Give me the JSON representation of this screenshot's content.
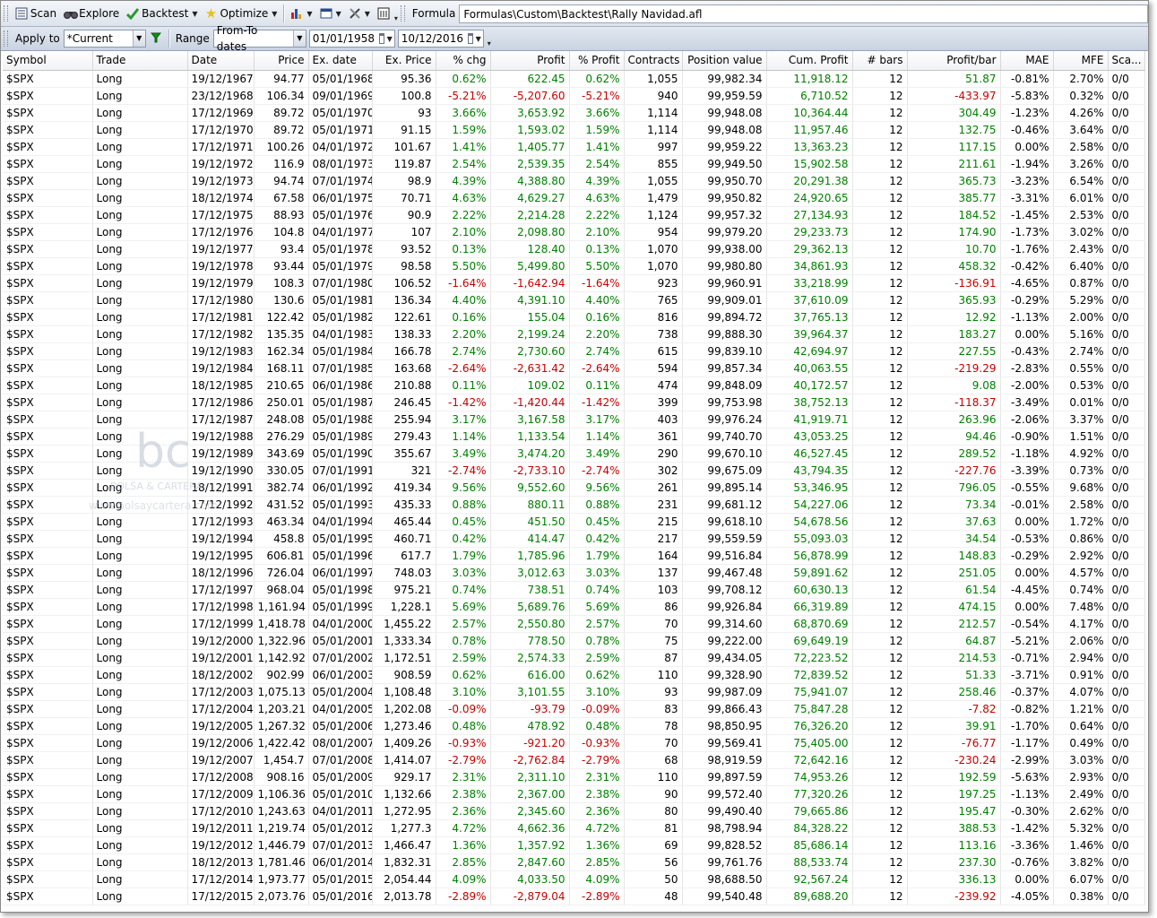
{
  "toolbar": {
    "scan_label": "Scan",
    "explore_label": "Explore",
    "backtest_label": "Backtest",
    "optimize_label": "Optimize",
    "formula_label": "Formula",
    "formula_value": "Formulas\\Custom\\Backtest\\Rally Navidad.afl"
  },
  "filter": {
    "apply_to_label": "Apply to",
    "apply_to_value": "*Current",
    "range_label": "Range",
    "range_value": "From-To dates",
    "from_date": "01/01/1958",
    "to_date": "10/12/2016"
  },
  "watermark": {
    "logo": "bc",
    "name": "BOLSA & CARTERA",
    "url": "www.bolsaycartera.com"
  },
  "colors": {
    "positive": "#008000",
    "negative": "#c80000"
  },
  "table": {
    "columns": [
      "Symbol",
      "Trade",
      "Date",
      "Price",
      "Ex. date",
      "Ex. Price",
      "% chg",
      "Profit",
      "% Profit",
      "Contracts",
      "Position value",
      "Cum. Profit",
      "# bars",
      "Profit/bar",
      "MAE",
      "MFE",
      "Sca..."
    ],
    "rows": [
      [
        "$SPX",
        "Long",
        "19/12/1967",
        "94.77",
        "05/01/1968",
        "95.36",
        "0.62%",
        "622.45",
        "0.62%",
        "1,055",
        "99,982.34",
        "11,918.12",
        "12",
        "51.87",
        "-0.81%",
        "2.70%",
        "0/0"
      ],
      [
        "$SPX",
        "Long",
        "23/12/1968",
        "106.34",
        "09/01/1969",
        "100.8",
        "-5.21%",
        "-5,207.60",
        "-5.21%",
        "940",
        "99,959.59",
        "6,710.52",
        "12",
        "-433.97",
        "-5.83%",
        "0.32%",
        "0/0"
      ],
      [
        "$SPX",
        "Long",
        "17/12/1969",
        "89.72",
        "05/01/1970",
        "93",
        "3.66%",
        "3,653.92",
        "3.66%",
        "1,114",
        "99,948.08",
        "10,364.44",
        "12",
        "304.49",
        "-1.23%",
        "4.26%",
        "0/0"
      ],
      [
        "$SPX",
        "Long",
        "17/12/1970",
        "89.72",
        "05/01/1971",
        "91.15",
        "1.59%",
        "1,593.02",
        "1.59%",
        "1,114",
        "99,948.08",
        "11,957.46",
        "12",
        "132.75",
        "-0.46%",
        "3.64%",
        "0/0"
      ],
      [
        "$SPX",
        "Long",
        "17/12/1971",
        "100.26",
        "04/01/1972",
        "101.67",
        "1.41%",
        "1,405.77",
        "1.41%",
        "997",
        "99,959.22",
        "13,363.23",
        "12",
        "117.15",
        "0.00%",
        "2.58%",
        "0/0"
      ],
      [
        "$SPX",
        "Long",
        "19/12/1972",
        "116.9",
        "08/01/1973",
        "119.87",
        "2.54%",
        "2,539.35",
        "2.54%",
        "855",
        "99,949.50",
        "15,902.58",
        "12",
        "211.61",
        "-1.94%",
        "3.26%",
        "0/0"
      ],
      [
        "$SPX",
        "Long",
        "19/12/1973",
        "94.74",
        "07/01/1974",
        "98.9",
        "4.39%",
        "4,388.80",
        "4.39%",
        "1,055",
        "99,950.70",
        "20,291.38",
        "12",
        "365.73",
        "-3.23%",
        "6.54%",
        "0/0"
      ],
      [
        "$SPX",
        "Long",
        "18/12/1974",
        "67.58",
        "06/01/1975",
        "70.71",
        "4.63%",
        "4,629.27",
        "4.63%",
        "1,479",
        "99,950.82",
        "24,920.65",
        "12",
        "385.77",
        "-3.31%",
        "6.01%",
        "0/0"
      ],
      [
        "$SPX",
        "Long",
        "17/12/1975",
        "88.93",
        "05/01/1976",
        "90.9",
        "2.22%",
        "2,214.28",
        "2.22%",
        "1,124",
        "99,957.32",
        "27,134.93",
        "12",
        "184.52",
        "-1.45%",
        "2.53%",
        "0/0"
      ],
      [
        "$SPX",
        "Long",
        "17/12/1976",
        "104.8",
        "04/01/1977",
        "107",
        "2.10%",
        "2,098.80",
        "2.10%",
        "954",
        "99,979.20",
        "29,233.73",
        "12",
        "174.90",
        "-1.73%",
        "3.02%",
        "0/0"
      ],
      [
        "$SPX",
        "Long",
        "19/12/1977",
        "93.4",
        "05/01/1978",
        "93.52",
        "0.13%",
        "128.40",
        "0.13%",
        "1,070",
        "99,938.00",
        "29,362.13",
        "12",
        "10.70",
        "-1.76%",
        "2.43%",
        "0/0"
      ],
      [
        "$SPX",
        "Long",
        "19/12/1978",
        "93.44",
        "05/01/1979",
        "98.58",
        "5.50%",
        "5,499.80",
        "5.50%",
        "1,070",
        "99,980.80",
        "34,861.93",
        "12",
        "458.32",
        "-0.42%",
        "6.40%",
        "0/0"
      ],
      [
        "$SPX",
        "Long",
        "19/12/1979",
        "108.3",
        "07/01/1980",
        "106.52",
        "-1.64%",
        "-1,642.94",
        "-1.64%",
        "923",
        "99,960.91",
        "33,218.99",
        "12",
        "-136.91",
        "-4.65%",
        "0.87%",
        "0/0"
      ],
      [
        "$SPX",
        "Long",
        "17/12/1980",
        "130.6",
        "05/01/1981",
        "136.34",
        "4.40%",
        "4,391.10",
        "4.40%",
        "765",
        "99,909.01",
        "37,610.09",
        "12",
        "365.93",
        "-0.29%",
        "5.29%",
        "0/0"
      ],
      [
        "$SPX",
        "Long",
        "17/12/1981",
        "122.42",
        "05/01/1982",
        "122.61",
        "0.16%",
        "155.04",
        "0.16%",
        "816",
        "99,894.72",
        "37,765.13",
        "12",
        "12.92",
        "-1.13%",
        "2.00%",
        "0/0"
      ],
      [
        "$SPX",
        "Long",
        "17/12/1982",
        "135.35",
        "04/01/1983",
        "138.33",
        "2.20%",
        "2,199.24",
        "2.20%",
        "738",
        "99,888.30",
        "39,964.37",
        "12",
        "183.27",
        "0.00%",
        "5.16%",
        "0/0"
      ],
      [
        "$SPX",
        "Long",
        "19/12/1983",
        "162.34",
        "05/01/1984",
        "166.78",
        "2.74%",
        "2,730.60",
        "2.74%",
        "615",
        "99,839.10",
        "42,694.97",
        "12",
        "227.55",
        "-0.43%",
        "2.74%",
        "0/0"
      ],
      [
        "$SPX",
        "Long",
        "19/12/1984",
        "168.11",
        "07/01/1985",
        "163.68",
        "-2.64%",
        "-2,631.42",
        "-2.64%",
        "594",
        "99,857.34",
        "40,063.55",
        "12",
        "-219.29",
        "-2.83%",
        "0.55%",
        "0/0"
      ],
      [
        "$SPX",
        "Long",
        "18/12/1985",
        "210.65",
        "06/01/1986",
        "210.88",
        "0.11%",
        "109.02",
        "0.11%",
        "474",
        "99,848.09",
        "40,172.57",
        "12",
        "9.08",
        "-2.00%",
        "0.53%",
        "0/0"
      ],
      [
        "$SPX",
        "Long",
        "17/12/1986",
        "250.01",
        "05/01/1987",
        "246.45",
        "-1.42%",
        "-1,420.44",
        "-1.42%",
        "399",
        "99,753.98",
        "38,752.13",
        "12",
        "-118.37",
        "-3.49%",
        "0.01%",
        "0/0"
      ],
      [
        "$SPX",
        "Long",
        "17/12/1987",
        "248.08",
        "05/01/1988",
        "255.94",
        "3.17%",
        "3,167.58",
        "3.17%",
        "403",
        "99,976.24",
        "41,919.71",
        "12",
        "263.96",
        "-2.06%",
        "3.37%",
        "0/0"
      ],
      [
        "$SPX",
        "Long",
        "19/12/1988",
        "276.29",
        "05/01/1989",
        "279.43",
        "1.14%",
        "1,133.54",
        "1.14%",
        "361",
        "99,740.70",
        "43,053.25",
        "12",
        "94.46",
        "-0.90%",
        "1.51%",
        "0/0"
      ],
      [
        "$SPX",
        "Long",
        "19/12/1989",
        "343.69",
        "05/01/1990",
        "355.67",
        "3.49%",
        "3,474.20",
        "3.49%",
        "290",
        "99,670.10",
        "46,527.45",
        "12",
        "289.52",
        "-1.18%",
        "4.92%",
        "0/0"
      ],
      [
        "$SPX",
        "Long",
        "19/12/1990",
        "330.05",
        "07/01/1991",
        "321",
        "-2.74%",
        "-2,733.10",
        "-2.74%",
        "302",
        "99,675.09",
        "43,794.35",
        "12",
        "-227.76",
        "-3.39%",
        "0.73%",
        "0/0"
      ],
      [
        "$SPX",
        "Long",
        "18/12/1991",
        "382.74",
        "06/01/1992",
        "419.34",
        "9.56%",
        "9,552.60",
        "9.56%",
        "261",
        "99,895.14",
        "53,346.95",
        "12",
        "796.05",
        "-0.55%",
        "9.68%",
        "0/0"
      ],
      [
        "$SPX",
        "Long",
        "17/12/1992",
        "431.52",
        "05/01/1993",
        "435.33",
        "0.88%",
        "880.11",
        "0.88%",
        "231",
        "99,681.12",
        "54,227.06",
        "12",
        "73.34",
        "-0.01%",
        "2.58%",
        "0/0"
      ],
      [
        "$SPX",
        "Long",
        "17/12/1993",
        "463.34",
        "04/01/1994",
        "465.44",
        "0.45%",
        "451.50",
        "0.45%",
        "215",
        "99,618.10",
        "54,678.56",
        "12",
        "37.63",
        "0.00%",
        "1.72%",
        "0/0"
      ],
      [
        "$SPX",
        "Long",
        "19/12/1994",
        "458.8",
        "05/01/1995",
        "460.71",
        "0.42%",
        "414.47",
        "0.42%",
        "217",
        "99,559.59",
        "55,093.03",
        "12",
        "34.54",
        "-0.53%",
        "0.86%",
        "0/0"
      ],
      [
        "$SPX",
        "Long",
        "19/12/1995",
        "606.81",
        "05/01/1996",
        "617.7",
        "1.79%",
        "1,785.96",
        "1.79%",
        "164",
        "99,516.84",
        "56,878.99",
        "12",
        "148.83",
        "-0.29%",
        "2.92%",
        "0/0"
      ],
      [
        "$SPX",
        "Long",
        "18/12/1996",
        "726.04",
        "06/01/1997",
        "748.03",
        "3.03%",
        "3,012.63",
        "3.03%",
        "137",
        "99,467.48",
        "59,891.62",
        "12",
        "251.05",
        "0.00%",
        "4.57%",
        "0/0"
      ],
      [
        "$SPX",
        "Long",
        "17/12/1997",
        "968.04",
        "05/01/1998",
        "975.21",
        "0.74%",
        "738.51",
        "0.74%",
        "103",
        "99,708.12",
        "60,630.13",
        "12",
        "61.54",
        "-4.45%",
        "0.74%",
        "0/0"
      ],
      [
        "$SPX",
        "Long",
        "17/12/1998",
        "1,161.94",
        "05/01/1999",
        "1,228.1",
        "5.69%",
        "5,689.76",
        "5.69%",
        "86",
        "99,926.84",
        "66,319.89",
        "12",
        "474.15",
        "0.00%",
        "7.48%",
        "0/0"
      ],
      [
        "$SPX",
        "Long",
        "17/12/1999",
        "1,418.78",
        "04/01/2000",
        "1,455.22",
        "2.57%",
        "2,550.80",
        "2.57%",
        "70",
        "99,314.60",
        "68,870.69",
        "12",
        "212.57",
        "-0.54%",
        "4.17%",
        "0/0"
      ],
      [
        "$SPX",
        "Long",
        "19/12/2000",
        "1,322.96",
        "05/01/2001",
        "1,333.34",
        "0.78%",
        "778.50",
        "0.78%",
        "75",
        "99,222.00",
        "69,649.19",
        "12",
        "64.87",
        "-5.21%",
        "2.06%",
        "0/0"
      ],
      [
        "$SPX",
        "Long",
        "19/12/2001",
        "1,142.92",
        "07/01/2002",
        "1,172.51",
        "2.59%",
        "2,574.33",
        "2.59%",
        "87",
        "99,434.05",
        "72,223.52",
        "12",
        "214.53",
        "-0.71%",
        "2.94%",
        "0/0"
      ],
      [
        "$SPX",
        "Long",
        "18/12/2002",
        "902.99",
        "06/01/2003",
        "908.59",
        "0.62%",
        "616.00",
        "0.62%",
        "110",
        "99,328.90",
        "72,839.52",
        "12",
        "51.33",
        "-3.71%",
        "0.91%",
        "0/0"
      ],
      [
        "$SPX",
        "Long",
        "17/12/2003",
        "1,075.13",
        "05/01/2004",
        "1,108.48",
        "3.10%",
        "3,101.55",
        "3.10%",
        "93",
        "99,987.09",
        "75,941.07",
        "12",
        "258.46",
        "-0.37%",
        "4.07%",
        "0/0"
      ],
      [
        "$SPX",
        "Long",
        "17/12/2004",
        "1,203.21",
        "04/01/2005",
        "1,202.08",
        "-0.09%",
        "-93.79",
        "-0.09%",
        "83",
        "99,866.43",
        "75,847.28",
        "12",
        "-7.82",
        "-0.82%",
        "1.21%",
        "0/0"
      ],
      [
        "$SPX",
        "Long",
        "19/12/2005",
        "1,267.32",
        "05/01/2006",
        "1,273.46",
        "0.48%",
        "478.92",
        "0.48%",
        "78",
        "98,850.95",
        "76,326.20",
        "12",
        "39.91",
        "-1.70%",
        "0.64%",
        "0/0"
      ],
      [
        "$SPX",
        "Long",
        "19/12/2006",
        "1,422.42",
        "08/01/2007",
        "1,409.26",
        "-0.93%",
        "-921.20",
        "-0.93%",
        "70",
        "99,569.41",
        "75,405.00",
        "12",
        "-76.77",
        "-1.17%",
        "0.49%",
        "0/0"
      ],
      [
        "$SPX",
        "Long",
        "19/12/2007",
        "1,454.7",
        "07/01/2008",
        "1,414.07",
        "-2.79%",
        "-2,762.84",
        "-2.79%",
        "68",
        "98,919.59",
        "72,642.16",
        "12",
        "-230.24",
        "-2.99%",
        "3.03%",
        "0/0"
      ],
      [
        "$SPX",
        "Long",
        "17/12/2008",
        "908.16",
        "05/01/2009",
        "929.17",
        "2.31%",
        "2,311.10",
        "2.31%",
        "110",
        "99,897.59",
        "74,953.26",
        "12",
        "192.59",
        "-5.63%",
        "2.93%",
        "0/0"
      ],
      [
        "$SPX",
        "Long",
        "17/12/2009",
        "1,106.36",
        "05/01/2010",
        "1,132.66",
        "2.38%",
        "2,367.00",
        "2.38%",
        "90",
        "99,572.40",
        "77,320.26",
        "12",
        "197.25",
        "-1.13%",
        "2.49%",
        "0/0"
      ],
      [
        "$SPX",
        "Long",
        "17/12/2010",
        "1,243.63",
        "04/01/2011",
        "1,272.95",
        "2.36%",
        "2,345.60",
        "2.36%",
        "80",
        "99,490.40",
        "79,665.86",
        "12",
        "195.47",
        "-0.30%",
        "2.62%",
        "0/0"
      ],
      [
        "$SPX",
        "Long",
        "19/12/2011",
        "1,219.74",
        "05/01/2012",
        "1,277.3",
        "4.72%",
        "4,662.36",
        "4.72%",
        "81",
        "98,798.94",
        "84,328.22",
        "12",
        "388.53",
        "-1.42%",
        "5.32%",
        "0/0"
      ],
      [
        "$SPX",
        "Long",
        "19/12/2012",
        "1,446.79",
        "07/01/2013",
        "1,466.47",
        "1.36%",
        "1,357.92",
        "1.36%",
        "69",
        "99,828.52",
        "85,686.14",
        "12",
        "113.16",
        "-3.36%",
        "1.46%",
        "0/0"
      ],
      [
        "$SPX",
        "Long",
        "18/12/2013",
        "1,781.46",
        "06/01/2014",
        "1,832.31",
        "2.85%",
        "2,847.60",
        "2.85%",
        "56",
        "99,761.76",
        "88,533.74",
        "12",
        "237.30",
        "-0.76%",
        "3.82%",
        "0/0"
      ],
      [
        "$SPX",
        "Long",
        "17/12/2014",
        "1,973.77",
        "05/01/2015",
        "2,054.44",
        "4.09%",
        "4,033.50",
        "4.09%",
        "50",
        "98,688.50",
        "92,567.24",
        "12",
        "336.13",
        "0.00%",
        "6.07%",
        "0/0"
      ],
      [
        "$SPX",
        "Long",
        "17/12/2015",
        "2,073.76",
        "05/01/2016",
        "2,013.78",
        "-2.89%",
        "-2,879.04",
        "-2.89%",
        "48",
        "99,540.48",
        "89,688.20",
        "12",
        "-239.92",
        "-4.05%",
        "0.38%",
        "0/0"
      ]
    ]
  }
}
